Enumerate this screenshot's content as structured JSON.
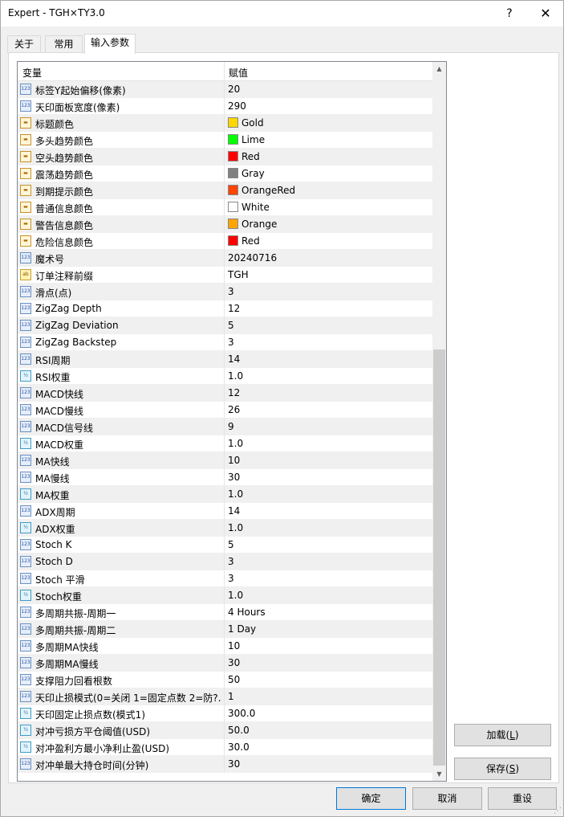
{
  "window": {
    "title": "Expert - TGH×TY3.0",
    "help_label": "?",
    "close_label": "✕"
  },
  "tabs": [
    {
      "label": "关于"
    },
    {
      "label": "常用"
    },
    {
      "label": "输入参数"
    }
  ],
  "grid": {
    "col_variable": "变量",
    "col_value": "赋值",
    "rows": [
      {
        "type": "int",
        "name": "标签Y起始偏移(像素)",
        "value": "20"
      },
      {
        "type": "int",
        "name": "天印面板宽度(像素)",
        "value": "290"
      },
      {
        "type": "color",
        "name": "标题颜色",
        "value": "Gold",
        "color": "#FFD700"
      },
      {
        "type": "color",
        "name": "多头趋势颜色",
        "value": "Lime",
        "color": "#00FF00"
      },
      {
        "type": "color",
        "name": "空头趋势颜色",
        "value": "Red",
        "color": "#FF0000"
      },
      {
        "type": "color",
        "name": "震荡趋势颜色",
        "value": "Gray",
        "color": "#808080"
      },
      {
        "type": "color",
        "name": "到期提示颜色",
        "value": "OrangeRed",
        "color": "#FF4500"
      },
      {
        "type": "color",
        "name": "普通信息颜色",
        "value": "White",
        "color": "#FFFFFF"
      },
      {
        "type": "color",
        "name": "警告信息颜色",
        "value": "Orange",
        "color": "#FFA500"
      },
      {
        "type": "color",
        "name": "危险信息颜色",
        "value": "Red",
        "color": "#FF0000"
      },
      {
        "type": "int",
        "name": "魔术号",
        "value": "20240716"
      },
      {
        "type": "string",
        "name": "订单注释前缀",
        "value": "TGH"
      },
      {
        "type": "int",
        "name": "滑点(点)",
        "value": "3"
      },
      {
        "type": "int",
        "name": "ZigZag Depth",
        "value": "12"
      },
      {
        "type": "int",
        "name": "ZigZag Deviation",
        "value": "5"
      },
      {
        "type": "int",
        "name": "ZigZag Backstep",
        "value": "3"
      },
      {
        "type": "int",
        "name": "RSI周期",
        "value": "14"
      },
      {
        "type": "double",
        "name": "RSI权重",
        "value": "1.0"
      },
      {
        "type": "int",
        "name": "MACD快线",
        "value": "12"
      },
      {
        "type": "int",
        "name": "MACD慢线",
        "value": "26"
      },
      {
        "type": "int",
        "name": "MACD信号线",
        "value": "9"
      },
      {
        "type": "double",
        "name": "MACD权重",
        "value": "1.0"
      },
      {
        "type": "int",
        "name": "MA快线",
        "value": "10"
      },
      {
        "type": "int",
        "name": "MA慢线",
        "value": "30"
      },
      {
        "type": "double",
        "name": "MA权重",
        "value": "1.0"
      },
      {
        "type": "int",
        "name": "ADX周期",
        "value": "14"
      },
      {
        "type": "double",
        "name": "ADX权重",
        "value": "1.0"
      },
      {
        "type": "int",
        "name": "Stoch K",
        "value": "5"
      },
      {
        "type": "int",
        "name": "Stoch D",
        "value": "3"
      },
      {
        "type": "int",
        "name": "Stoch 平滑",
        "value": "3"
      },
      {
        "type": "double",
        "name": "Stoch权重",
        "value": "1.0"
      },
      {
        "type": "int",
        "name": "多周期共振-周期一",
        "value": "4 Hours"
      },
      {
        "type": "int",
        "name": "多周期共振-周期二",
        "value": "1 Day"
      },
      {
        "type": "int",
        "name": "多周期MA快线",
        "value": "10"
      },
      {
        "type": "int",
        "name": "多周期MA慢线",
        "value": "30"
      },
      {
        "type": "int",
        "name": "支撑阻力回看根数",
        "value": "50"
      },
      {
        "type": "int",
        "name": "天印止损模式(0=关闭 1=固定点数 2=防?..",
        "value": "1"
      },
      {
        "type": "double",
        "name": "天印固定止损点数(模式1)",
        "value": "300.0"
      },
      {
        "type": "double",
        "name": "对冲亏损方平仓阈值(USD)",
        "value": "50.0"
      },
      {
        "type": "double",
        "name": "对冲盈利方最小净利止盈(USD)",
        "value": "30.0"
      },
      {
        "type": "int",
        "name": "对冲单最大持仓时间(分钟)",
        "value": "30"
      }
    ]
  },
  "icons": {
    "int": "123",
    "double": "½",
    "string": "ab",
    "color": "▬"
  },
  "scrollbar": {
    "up_arrow": "▲",
    "down_arrow": "▼"
  },
  "buttons": {
    "load_label": "加载(",
    "load_key": "L",
    "load_end": ")",
    "save_label": "保存(",
    "save_key": "S",
    "save_end": ")",
    "ok_label": "确定",
    "cancel_label": "取消",
    "reset_label": "重设"
  }
}
